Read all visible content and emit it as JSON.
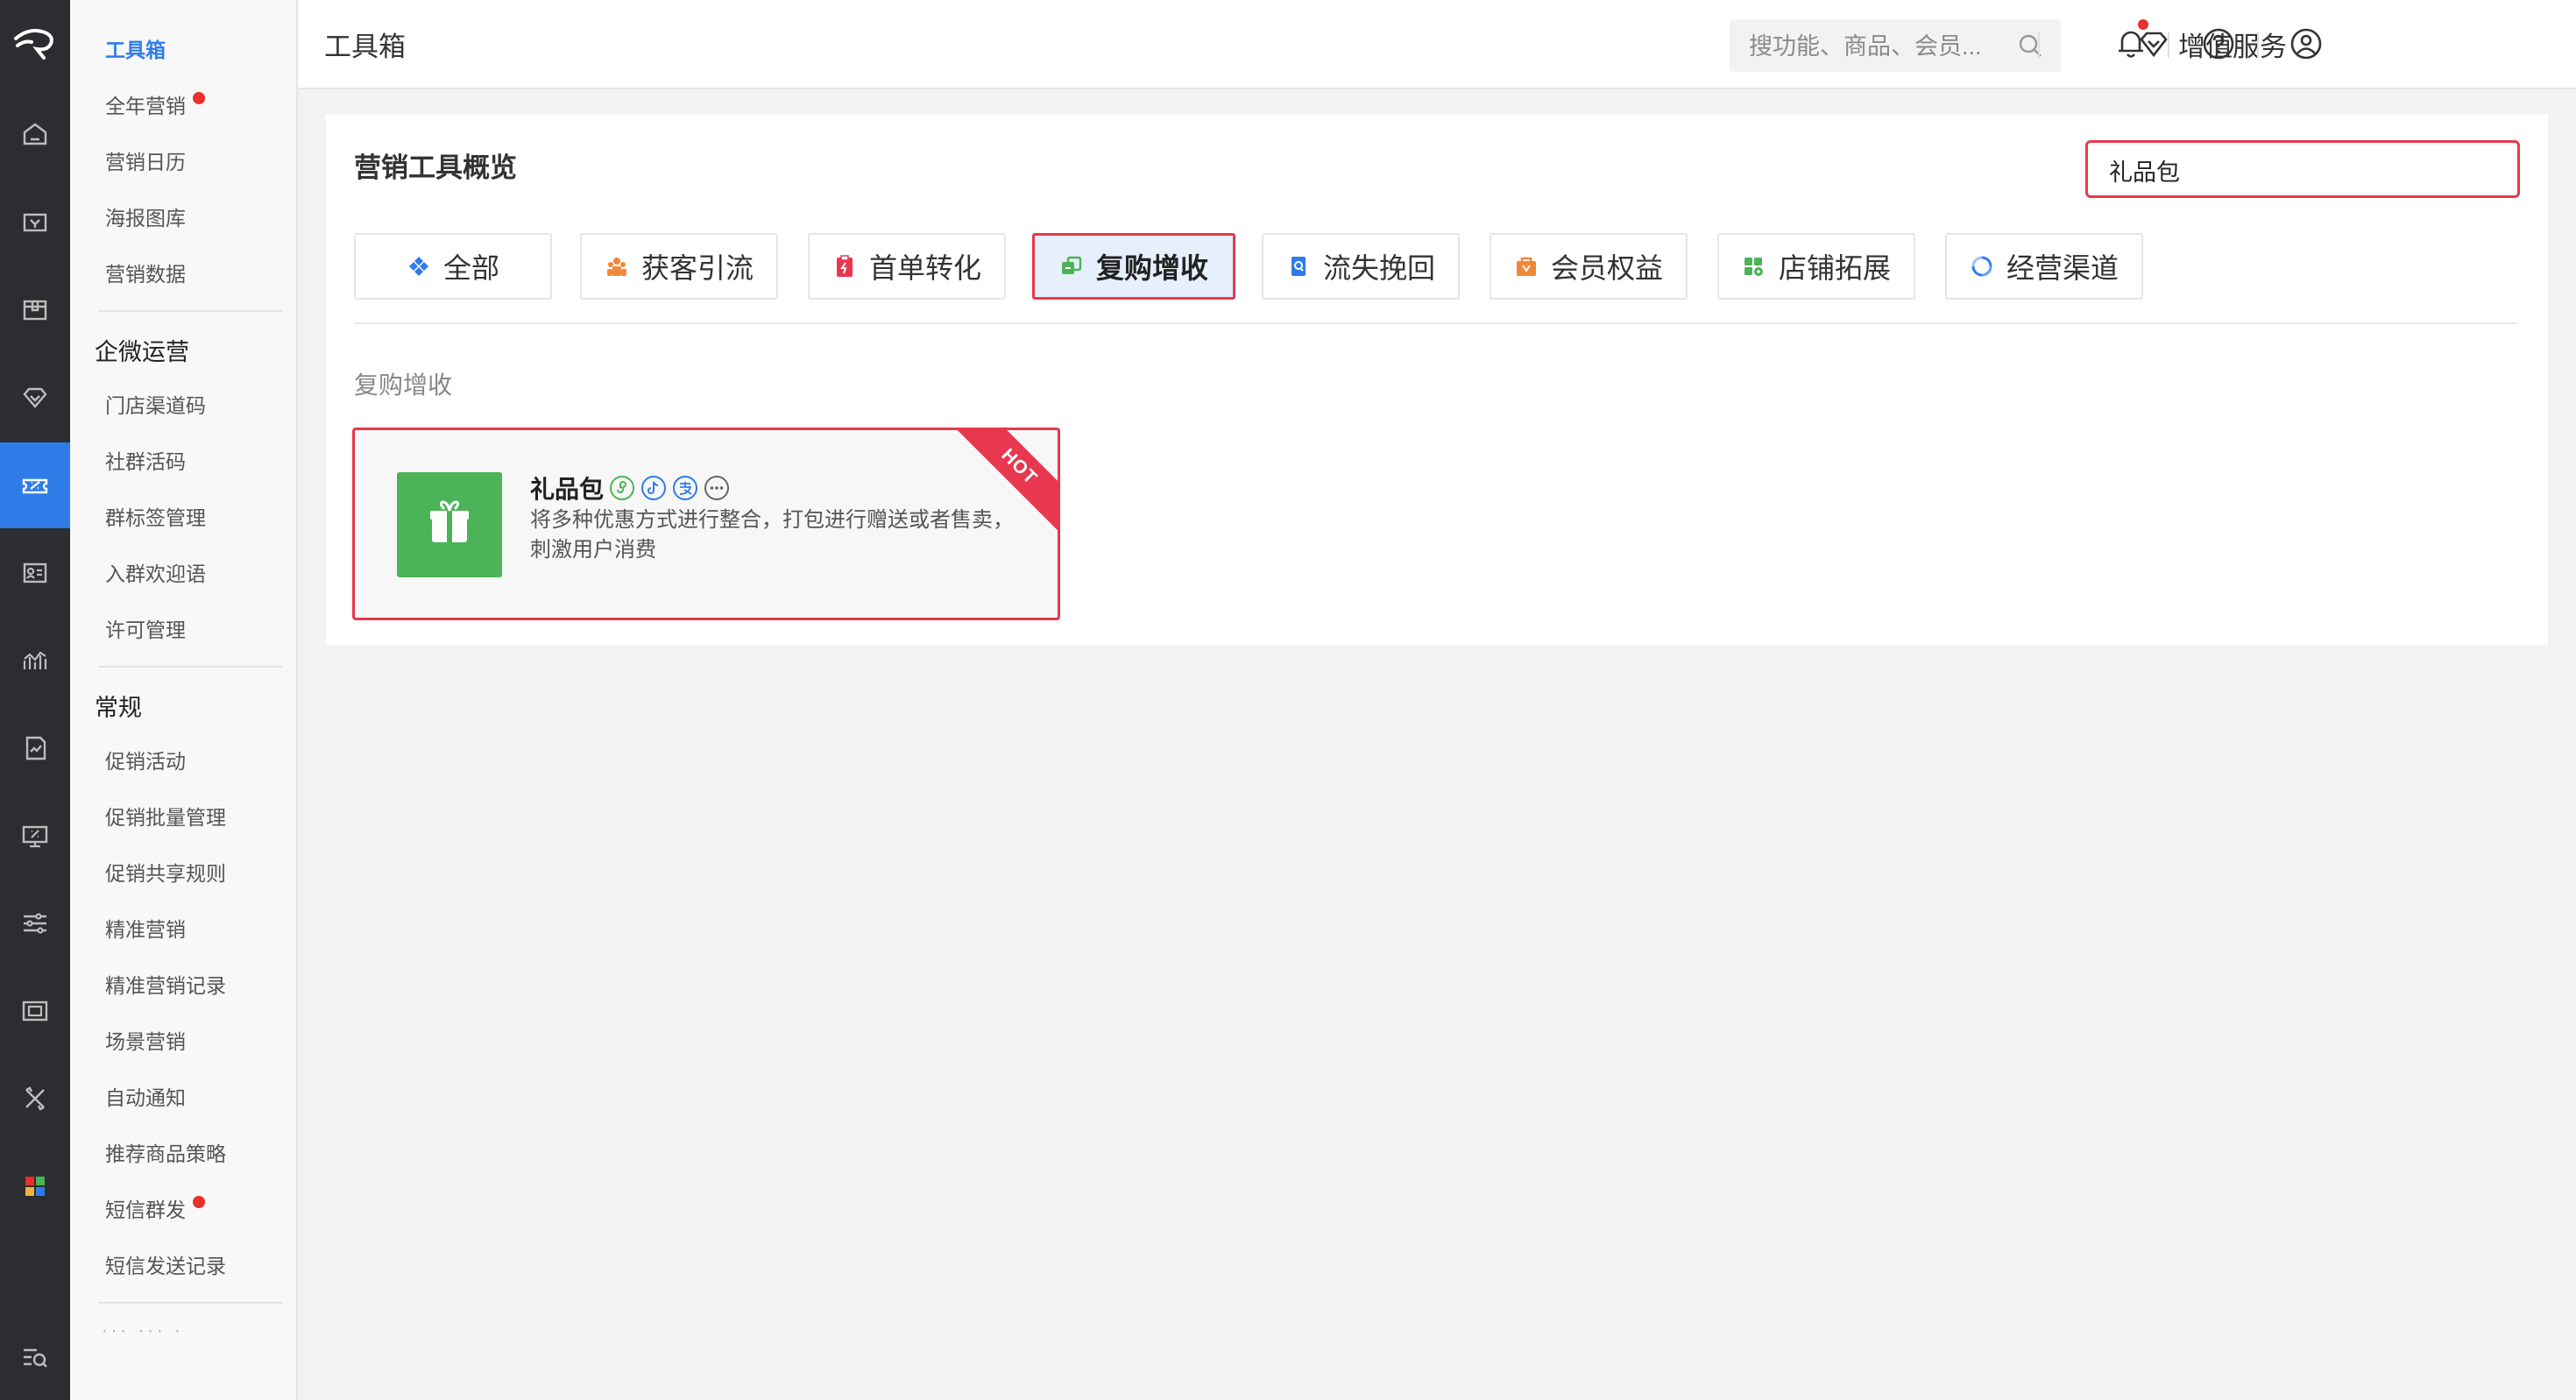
{
  "colors": {
    "accent": "#2f7ce8",
    "highlight_border": "#e8384f",
    "rail_bg": "#2c2d30",
    "card_icon_bg": "#4cb356",
    "badge_dot": "#e8302f"
  },
  "header": {
    "title": "工具箱",
    "search_placeholder": "搜功能、商品、会员...",
    "value_added_label": "增值服务",
    "icons": [
      "diamond-icon",
      "bell-icon",
      "help-icon",
      "user-icon"
    ]
  },
  "rail": {
    "icons": [
      "logo-icon",
      "home-icon",
      "shop-icon",
      "goods-icon",
      "member-icon",
      "marketing-icon",
      "customer-icon",
      "data-icon",
      "report-icon",
      "asset-icon",
      "settings-icon",
      "channel-icon",
      "tools-icon",
      "apps-icon",
      "search-menu-icon"
    ],
    "active": "marketing-icon"
  },
  "subnav": {
    "items_top": [
      {
        "label": "工具箱",
        "active": true
      },
      {
        "label": "全年营销",
        "dot": true
      },
      {
        "label": "营销日历"
      },
      {
        "label": "海报图库"
      },
      {
        "label": "营销数据"
      }
    ],
    "group_wecom": {
      "title": "企微运营",
      "items": [
        "门店渠道码",
        "社群活码",
        "群标签管理",
        "入群欢迎语",
        "许可管理"
      ]
    },
    "group_general": {
      "title": "常规",
      "items": [
        "促销活动",
        "促销批量管理",
        "促销共享规则",
        "精准营销",
        "精准营销记录",
        "场景营销",
        "自动通知",
        "推荐商品策略",
        "短信群发",
        "短信发送记录"
      ]
    },
    "more_label": "··· ··· ·"
  },
  "main": {
    "title": "营销工具概览",
    "search_value": "礼品包",
    "tabs": [
      {
        "label": "全部",
        "icon": "grid-icon",
        "color": "#2f7ce8"
      },
      {
        "label": "获客引流",
        "icon": "people-icon",
        "color": "#f0883a"
      },
      {
        "label": "首单转化",
        "icon": "clipboard-icon",
        "color": "#e8384f"
      },
      {
        "label": "复购增收",
        "icon": "repeat-icon",
        "color": "#4cb356",
        "active": true
      },
      {
        "label": "流失挽回",
        "icon": "recover-icon",
        "color": "#2f7ce8"
      },
      {
        "label": "会员权益",
        "icon": "vip-icon",
        "color": "#f0883a"
      },
      {
        "label": "店铺拓展",
        "icon": "store-icon",
        "color": "#4cb356"
      },
      {
        "label": "经营渠道",
        "icon": "channel-cycle-icon",
        "color": "#2f7ce8"
      }
    ],
    "section_label": "复购增收",
    "tool_card": {
      "name": "礼品包",
      "description": "将多种优惠方式进行整合，打包进行赠送或者售卖，刺激用户消费",
      "badge": "HOT",
      "channel_icons": [
        "miniprogram-icon",
        "douyin-icon",
        "alipay-icon",
        "more-channels-icon"
      ]
    }
  }
}
